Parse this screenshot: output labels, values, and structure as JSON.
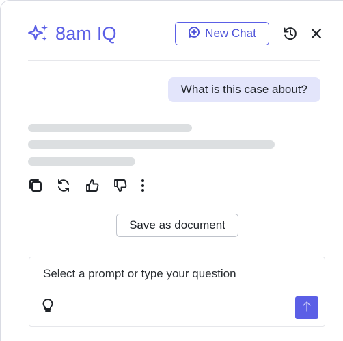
{
  "header": {
    "title": "8am IQ",
    "brand_icon": "sparkles-icon",
    "new_chat_label": "New Chat",
    "new_chat_icon": "chat-plus-icon",
    "history_icon": "history-icon",
    "close_icon": "close-icon"
  },
  "conversation": {
    "user_message": "What is this case about?",
    "assistant_state": "loading",
    "actions": [
      {
        "name": "copy",
        "icon": "copy-icon"
      },
      {
        "name": "regenerate",
        "icon": "refresh-icon"
      },
      {
        "name": "like",
        "icon": "thumbs-up-icon"
      },
      {
        "name": "dislike",
        "icon": "thumbs-down-icon"
      },
      {
        "name": "more",
        "icon": "more-vertical-icon"
      }
    ],
    "save_document_label": "Save as document"
  },
  "composer": {
    "placeholder": "Select a prompt or type your question",
    "value": "",
    "prompt_icon": "lightbulb-icon",
    "send_icon": "arrow-up-icon"
  },
  "colors": {
    "accent": "#5b5fe6",
    "user_bubble": "#e3e5fb",
    "skeleton": "#dcdfe1",
    "border": "#e6e7eb"
  }
}
